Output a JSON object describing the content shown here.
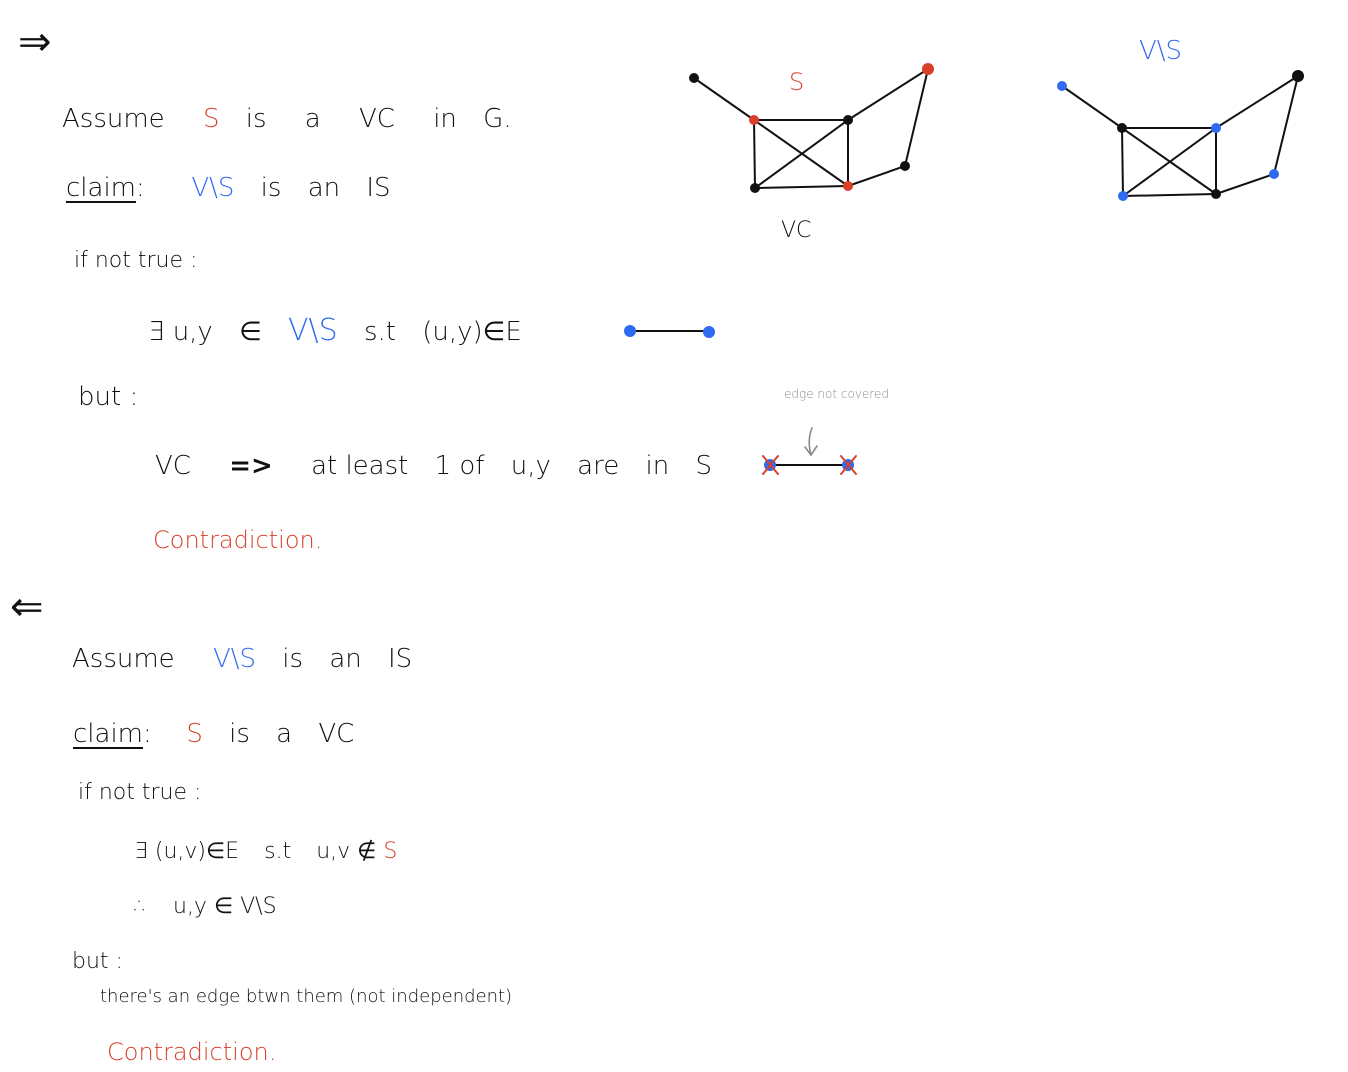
{
  "forward": {
    "arrow": "⇒",
    "assume": [
      "Assume",
      "S",
      "is",
      "a",
      "VC",
      "in",
      "G."
    ],
    "claim_label": "claim",
    "claim": [
      "V\\S",
      "is",
      "an",
      "IS"
    ],
    "if_not_true": "if not true :",
    "exists": [
      "∃ u,y",
      "∈",
      "V\\S",
      "s.t",
      "(u,y)∈E"
    ],
    "but": "but :",
    "vc_line": [
      "VC",
      "=>",
      "at least",
      "1 of",
      "u,y",
      "are",
      "in",
      "S"
    ],
    "contradiction": "Contradiction.",
    "edge_note": "edge not covered"
  },
  "backward": {
    "arrow": "⇐",
    "assume": [
      "Assume",
      "V\\S",
      "is",
      "an",
      "IS"
    ],
    "claim_label": "claim",
    "claim": [
      "S",
      "is",
      "a",
      "VC"
    ],
    "if_not_true": "if not true :",
    "exists": [
      "∃ (u,v)∈E",
      "s.t",
      "u,v ∉",
      "S"
    ],
    "therefore": [
      "∴",
      "u,y ∈ V\\S"
    ],
    "but": "but :",
    "note": "there's an edge btwn them (not independent)",
    "contradiction": "Contradiction."
  },
  "graphs": {
    "left_label_top": "S",
    "left_label_bottom": "VC",
    "right_label_top": "V\\S"
  },
  "colors": {
    "red": "#d8402a",
    "blue": "#2f6bf0",
    "black": "#111111",
    "gray": "#8a8a8a"
  }
}
